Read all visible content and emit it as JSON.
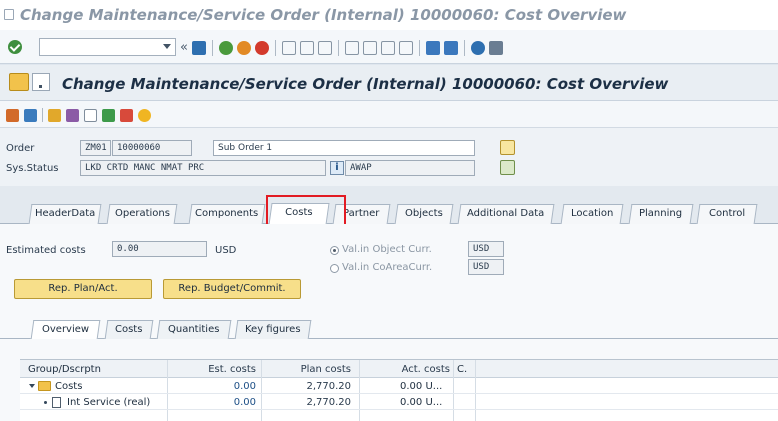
{
  "window": {
    "title": "Change Maintenance/Service Order (Internal) 10000060: Cost Overview"
  },
  "page": {
    "title": "Change Maintenance/Service Order (Internal) 10000060: Cost Overview"
  },
  "header": {
    "order_label": "Order",
    "order_type": "ZM01",
    "order_number": "10000060",
    "order_description": "Sub Order 1",
    "sys_status_label": "Sys.Status",
    "sys_status_value": "LKD  CRTD MANC NMAT PRC",
    "user_status_value": "AWAP"
  },
  "tabs": [
    {
      "label": "HeaderData"
    },
    {
      "label": "Operations"
    },
    {
      "label": "Components"
    },
    {
      "label": "Costs"
    },
    {
      "label": "Partner"
    },
    {
      "label": "Objects"
    },
    {
      "label": "Additional Data"
    },
    {
      "label": "Location"
    },
    {
      "label": "Planning"
    },
    {
      "label": "Control"
    }
  ],
  "costs": {
    "estimated_costs_label": "Estimated costs",
    "estimated_costs_value": "0.00",
    "currency": "USD",
    "radio_object_currency": "Val.in Object Curr.",
    "radio_object_currency_value": "USD",
    "radio_coarea_currency": "Val.in CoAreaCurr.",
    "radio_coarea_currency_value": "USD",
    "btn_plan_act": "Rep. Plan/Act.",
    "btn_budget_commit": "Rep. Budget/Commit."
  },
  "subtabs": [
    {
      "label": "Overview"
    },
    {
      "label": "Costs"
    },
    {
      "label": "Quantities"
    },
    {
      "label": "Key figures"
    }
  ],
  "grid": {
    "columns": [
      "Group/Dscrptn",
      "Est. costs",
      "Plan costs",
      "Act. costs",
      "C."
    ],
    "rows": [
      {
        "desc": "Costs",
        "est": "0.00",
        "plan": "2,770.20",
        "act": "0.00 U..."
      },
      {
        "desc": "Int Service (real)",
        "est": "0.00",
        "plan": "2,770.20",
        "act": "0.00 U..."
      }
    ]
  },
  "colors": {
    "highlight": "#e21b23",
    "button_yellow": "#f7df8a",
    "title_blue": "#1c2f45"
  }
}
